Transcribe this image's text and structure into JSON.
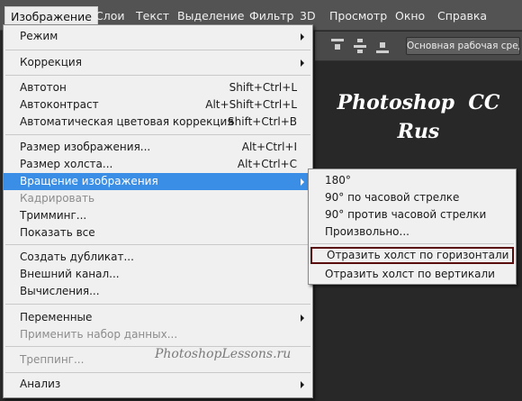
{
  "menubar": {
    "items": [
      "Изображение",
      "Слои",
      "Текст",
      "Выделение",
      "Фильтр",
      "3D",
      "Просмотр",
      "Окно",
      "Справка"
    ],
    "active_index": 0
  },
  "options_bar": {
    "workspace_button": "Основная рабочая среда",
    "icons": [
      "align-top-icon",
      "align-vcenter-icon",
      "align-bottom-icon"
    ]
  },
  "canvas": {
    "title_line1": "Photoshop  CC",
    "title_line2": "Rus"
  },
  "image_menu": {
    "mode": {
      "label": "Режим"
    },
    "adjustments": {
      "label": "Коррекция"
    },
    "auto_tone": {
      "label": "Автотон",
      "shortcut": "Shift+Ctrl+L"
    },
    "auto_contrast": {
      "label": "Автоконтраст",
      "shortcut": "Alt+Shift+Ctrl+L"
    },
    "auto_color": {
      "label": "Автоматическая цветовая коррекция",
      "shortcut": "Shift+Ctrl+B"
    },
    "image_size": {
      "label": "Размер изображения...",
      "shortcut": "Alt+Ctrl+I"
    },
    "canvas_size": {
      "label": "Размер холста...",
      "shortcut": "Alt+Ctrl+C"
    },
    "image_rotation": {
      "label": "Вращение изображения"
    },
    "crop": {
      "label": "Кадрировать"
    },
    "trim": {
      "label": "Тримминг..."
    },
    "reveal_all": {
      "label": "Показать все"
    },
    "duplicate": {
      "label": "Создать дубликат..."
    },
    "apply_image": {
      "label": "Внешний канал..."
    },
    "calculations": {
      "label": "Вычисления..."
    },
    "variables": {
      "label": "Переменные"
    },
    "apply_data_set": {
      "label": "Применить набор данных..."
    },
    "trap": {
      "label": "Треппинг..."
    },
    "analysis": {
      "label": "Анализ"
    }
  },
  "rotation_submenu": {
    "rotate_180": "180°",
    "rotate_90_cw": "90° по часовой стрелке",
    "rotate_90_ccw": "90° против часовой стрелки",
    "arbitrary": "Произвольно...",
    "flip_horizontal": "Отразить холст по горизонтали",
    "flip_vertical": "Отразить холст по вертикали"
  },
  "watermark": "PhotoshopLessons.ru",
  "colors": {
    "highlight": "#3a8ee6",
    "menu_bg": "#f0f0f0",
    "selection_box": "#5a0d0d",
    "canvas_bg": "#282828"
  }
}
